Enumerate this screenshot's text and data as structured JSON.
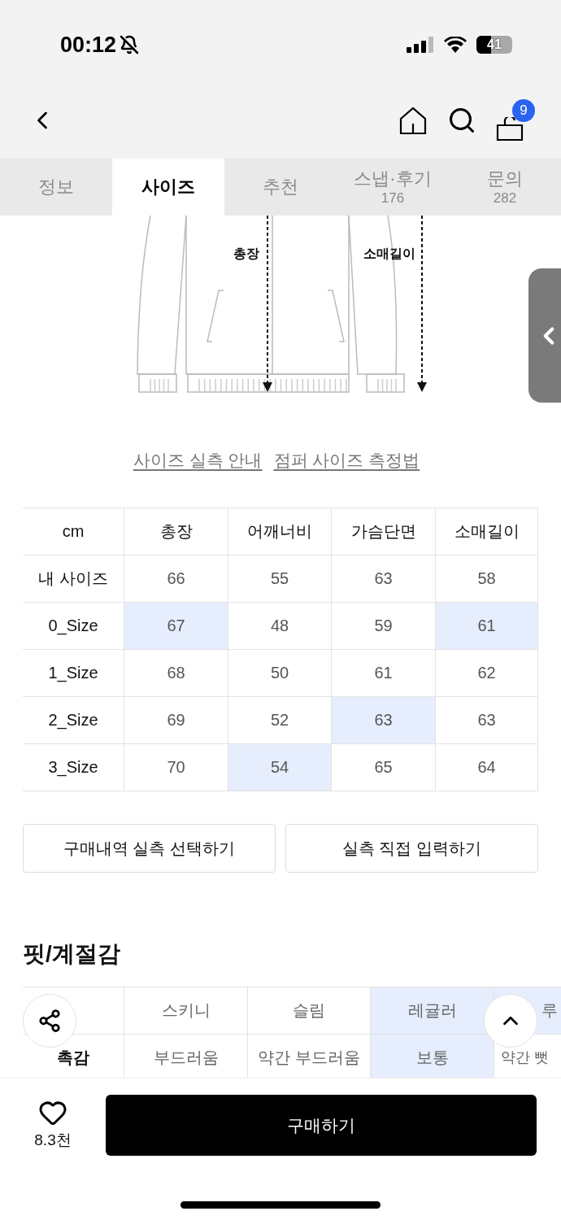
{
  "status_bar": {
    "time": "00:12",
    "battery": "41"
  },
  "nav": {
    "cart_count": "9"
  },
  "tabs": [
    {
      "label": "정보",
      "selected": false
    },
    {
      "label": "사이즈",
      "selected": true
    },
    {
      "label": "추천",
      "selected": false
    },
    {
      "label": "스냅·후기",
      "count": "176",
      "selected": false
    },
    {
      "label": "문의",
      "count": "282",
      "selected": false
    }
  ],
  "diagram": {
    "labels": [
      "총장",
      "소매길이"
    ]
  },
  "links": [
    "사이즈 실측 안내",
    "점퍼 사이즈 측정법"
  ],
  "size_table": {
    "corner_label": "cm",
    "columns": [
      "총장",
      "어깨너비",
      "가슴단면",
      "소매길이"
    ],
    "rows": [
      {
        "label": "내 사이즈",
        "cells": [
          {
            "text": "66",
            "highlighted": false
          },
          {
            "text": "55",
            "highlighted": false
          },
          {
            "text": "63",
            "highlighted": false
          },
          {
            "text": "58",
            "highlighted": false
          }
        ]
      },
      {
        "label": "0_Size",
        "cells": [
          {
            "text": "67",
            "highlighted": true
          },
          {
            "text": "48",
            "highlighted": false
          },
          {
            "text": "59",
            "highlighted": false
          },
          {
            "text": "61",
            "highlighted": true
          }
        ]
      },
      {
        "label": "1_Size",
        "cells": [
          {
            "text": "68",
            "highlighted": false
          },
          {
            "text": "50",
            "highlighted": false
          },
          {
            "text": "61",
            "highlighted": false
          },
          {
            "text": "62",
            "highlighted": false
          }
        ]
      },
      {
        "label": "2_Size",
        "cells": [
          {
            "text": "69",
            "highlighted": false
          },
          {
            "text": "52",
            "highlighted": false
          },
          {
            "text": "63",
            "highlighted": true
          },
          {
            "text": "63",
            "highlighted": false
          }
        ]
      },
      {
        "label": "3_Size",
        "cells": [
          {
            "text": "70",
            "highlighted": false
          },
          {
            "text": "54",
            "highlighted": true
          },
          {
            "text": "65",
            "highlighted": false
          },
          {
            "text": "64",
            "highlighted": false
          }
        ]
      }
    ]
  },
  "action_buttons": [
    "구매내역 실측 선택하기",
    "실측 직접 입력하기"
  ],
  "fit_section": {
    "title": "핏/계절감",
    "rows": [
      {
        "cells": [
          {
            "text": "스키니",
            "highlighted": false
          },
          {
            "text": "슬림",
            "highlighted": false
          },
          {
            "text": "레귤러",
            "highlighted": true
          },
          {
            "text": "루",
            "highlighted": true
          }
        ]
      },
      {
        "label": "촉감",
        "cells": [
          {
            "text": "부드러움",
            "highlighted": false
          },
          {
            "text": "약간 부드러움",
            "highlighted": false
          },
          {
            "text": "보통",
            "highlighted": true
          },
          {
            "text": "약간 뻣",
            "highlighted": false
          }
        ]
      }
    ]
  },
  "bottom_bar": {
    "likes": "8.3천",
    "buy_button": "구매하기"
  }
}
